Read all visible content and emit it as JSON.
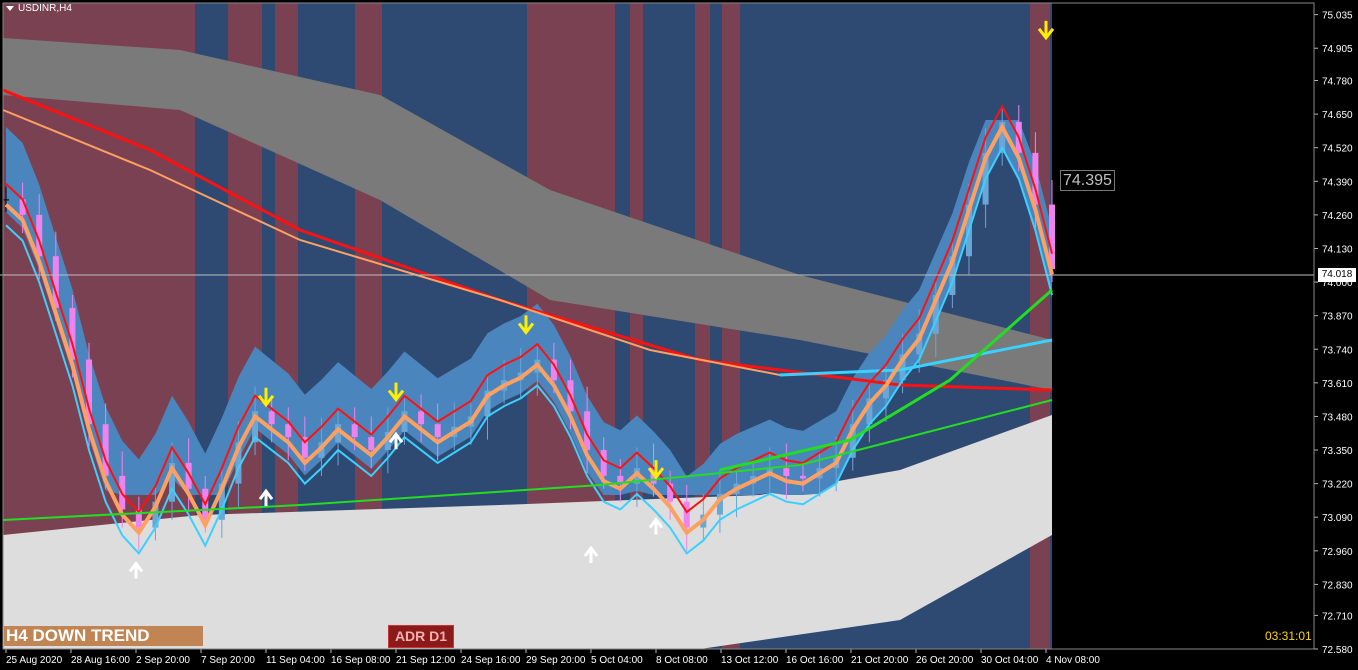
{
  "header": {
    "symbol_label": "USDINR,H4"
  },
  "badges": {
    "trend": "H4 DOWN TREND",
    "adr": "ADR D1",
    "countdown": "03:31:01"
  },
  "price_labels": {
    "last": "74.395",
    "current": "74.018"
  },
  "colors": {
    "background": "#000000",
    "plot_blue": "#2e4a72",
    "plot_maroon": "#7a4153",
    "candle_up": "#6aa6d6",
    "candle_down": "#ee82ee",
    "candle_neutral": "#000000",
    "ma_red": "#ff1010",
    "ma_orange": "#ffa060",
    "ma_cyan": "#3ad0ff",
    "ma_green": "#22dd22",
    "band_gray": "#7a7a7a",
    "band_light": "#dddddd",
    "band_blue": "#4a86bd",
    "arrow_down": "#ffee00",
    "arrow_up": "#ffffff",
    "axis_text": "#ffffff"
  },
  "chart_data": {
    "type": "candlestick",
    "symbol": "USDINR",
    "timeframe": "H4",
    "ylim": [
      72.58,
      75.08
    ],
    "y_ticks": [
      "75.035",
      "74.905",
      "74.780",
      "74.650",
      "74.520",
      "74.390",
      "74.260",
      "74.130",
      "74.000",
      "73.870",
      "73.740",
      "73.610",
      "73.480",
      "73.350",
      "73.220",
      "73.090",
      "72.960",
      "72.830",
      "72.710",
      "72.580"
    ],
    "x_ticks": [
      "25 Aug 2020",
      "28 Aug 16:00",
      "2 Sep 20:00",
      "7 Sep 20:00",
      "11 Sep 04:00",
      "16 Sep 08:00",
      "21 Sep 12:00",
      "24 Sep 16:00",
      "29 Sep 20:00",
      "5 Oct 04:00",
      "8 Oct 08:00",
      "13 Oct 12:00",
      "16 Oct 16:00",
      "21 Oct 20:00",
      "26 Oct 20:00",
      "30 Oct 04:00",
      "4 Nov 08:00"
    ],
    "current_price": 74.018,
    "last_price_label": 74.395,
    "close_series": [
      74.32,
      74.26,
      74.1,
      73.9,
      73.7,
      73.45,
      73.25,
      73.12,
      73.05,
      73.15,
      73.3,
      73.2,
      73.08,
      73.22,
      73.38,
      73.5,
      73.45,
      73.4,
      73.32,
      73.38,
      73.45,
      73.4,
      73.35,
      73.42,
      73.5,
      73.45,
      73.4,
      73.44,
      73.48,
      73.58,
      73.62,
      73.65,
      73.7,
      73.62,
      73.5,
      73.35,
      73.25,
      73.22,
      73.28,
      73.22,
      73.15,
      73.05,
      73.1,
      73.18,
      73.22,
      73.25,
      73.28,
      73.25,
      73.24,
      73.28,
      73.32,
      73.45,
      73.55,
      73.62,
      73.72,
      73.8,
      73.95,
      74.1,
      74.3,
      74.5,
      74.62,
      74.5,
      74.3,
      74.05
    ],
    "arrows_down": [
      {
        "x": "11 Sep 04:00",
        "y": 73.56
      },
      {
        "x": "21 Sep 12:00",
        "y": 73.58
      },
      {
        "x": "29 Sep 20:00",
        "y": 73.84
      },
      {
        "x": "8 Oct 08:00",
        "y": 73.28
      },
      {
        "x": "4 Nov 08:00",
        "y": 74.98
      }
    ],
    "arrows_up": [
      {
        "x": "2 Sep 20:00",
        "y": 72.88
      },
      {
        "x": "11 Sep 04:00",
        "y": 73.16
      },
      {
        "x": "21 Sep 12:00",
        "y": 73.38
      },
      {
        "x": "5 Oct 04:00",
        "y": 72.94
      },
      {
        "x": "8 Oct 08:00",
        "y": 73.05
      }
    ]
  }
}
